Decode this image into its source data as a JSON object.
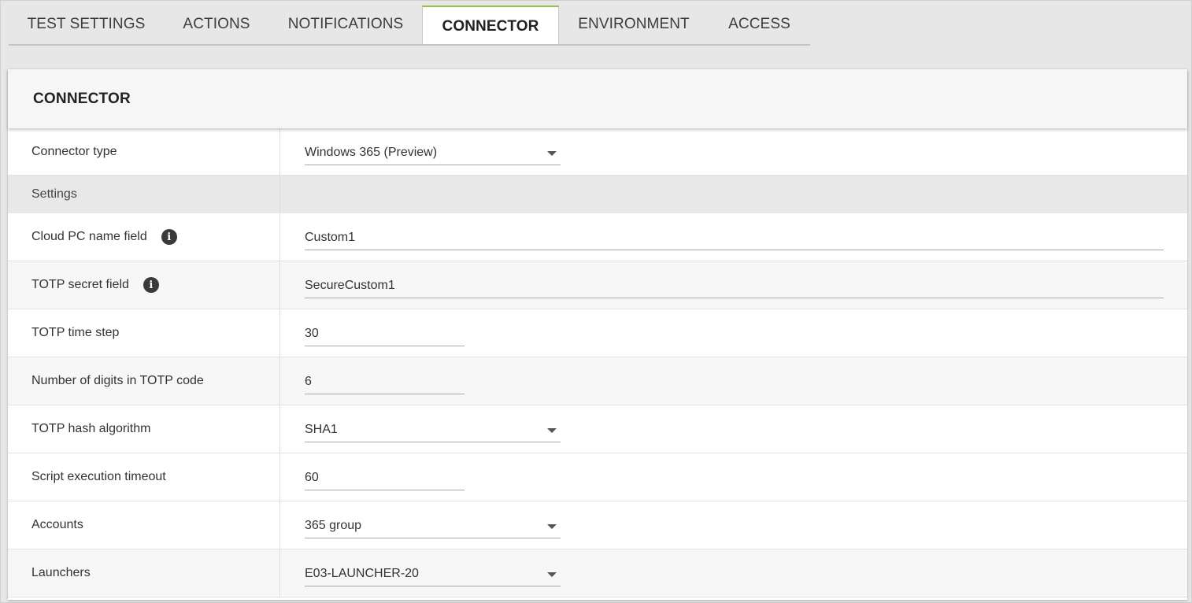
{
  "tabs": [
    {
      "label": "TEST SETTINGS"
    },
    {
      "label": "ACTIONS"
    },
    {
      "label": "NOTIFICATIONS"
    },
    {
      "label": "CONNECTOR"
    },
    {
      "label": "ENVIRONMENT"
    },
    {
      "label": "ACCESS"
    }
  ],
  "active_tab": "CONNECTOR",
  "accent_color": "#8cc63f",
  "panel": {
    "title": "CONNECTOR",
    "connector_type": {
      "label": "Connector type",
      "value": "Windows 365 (Preview)"
    },
    "settings_section": "Settings",
    "fields": {
      "cloud_pc_name": {
        "label": "Cloud PC name field",
        "value": "Custom1",
        "icon": "info-icon"
      },
      "totp_secret": {
        "label": "TOTP secret field",
        "value": "SecureCustom1",
        "icon": "info-icon"
      },
      "totp_time_step": {
        "label": "TOTP time step",
        "value": "30"
      },
      "totp_digits": {
        "label": "Number of digits in TOTP code",
        "value": "6"
      },
      "totp_hash": {
        "label": "TOTP hash algorithm",
        "value": "SHA1"
      },
      "script_timeout": {
        "label": "Script execution timeout",
        "value": "60"
      },
      "accounts": {
        "label": "Accounts",
        "value": "365 group"
      },
      "launchers": {
        "label": "Launchers",
        "value": "E03-LAUNCHER-20"
      }
    }
  }
}
